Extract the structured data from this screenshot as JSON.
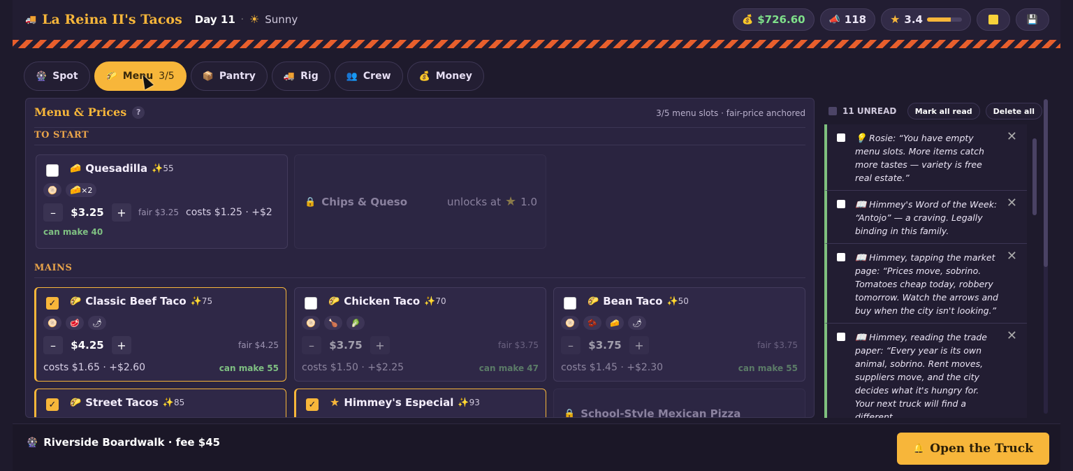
{
  "header": {
    "truck_name": "La Reina II's Tacos",
    "day": "Day 11",
    "weather": "Sunny",
    "money": "$726.60",
    "fans": "118",
    "rating": "3.4",
    "rating_fraction": 0.68
  },
  "tabs": [
    {
      "label": "Spot",
      "icon": "ferris-wheel-icon"
    },
    {
      "label": "Menu",
      "count": "3/5",
      "icon": "taco-icon"
    },
    {
      "label": "Pantry",
      "icon": "box-icon"
    },
    {
      "label": "Rig",
      "icon": "truck-icon"
    },
    {
      "label": "Crew",
      "icon": "people-icon"
    },
    {
      "label": "Money",
      "icon": "money-bag-icon"
    }
  ],
  "menu": {
    "title": "Menu & Prices",
    "help": "?",
    "note": "3/5 menu slots · fair-price anchored",
    "sections": {
      "start": "TO START",
      "mains": "MAINS"
    },
    "quesadilla": {
      "name": "Quesadilla",
      "score": "55",
      "extra": "×2",
      "price": "$3.25",
      "fair": "fair $3.25",
      "costs": "costs $1.25 · +$2",
      "make": "can make 40"
    },
    "chips": {
      "name": "Chips & Queso",
      "unlock": "unlocks at",
      "unlock_value": "1.0"
    },
    "beef": {
      "name": "Classic Beef Taco",
      "score": "75",
      "price": "$4.25",
      "fair": "fair $4.25",
      "costs": "costs $1.65 · +$2.60",
      "make": "can make 55"
    },
    "chicken": {
      "name": "Chicken Taco",
      "score": "70",
      "price": "$3.75",
      "fair": "fair $3.75",
      "costs": "costs $1.50 · +$2.25",
      "make": "can make 47"
    },
    "bean": {
      "name": "Bean Taco",
      "score": "50",
      "price": "$3.75",
      "fair": "fair $3.75",
      "costs": "costs $1.45 · +$2.30",
      "make": "can make 55"
    },
    "street": {
      "name": "Street Tacos",
      "score": "85"
    },
    "especial": {
      "name": "Himmey's Especial",
      "score": "93"
    },
    "pizza": {
      "name": "School-Style Mexican Pizza"
    }
  },
  "inbox": {
    "unread": "11 UNREAD",
    "mark_all": "Mark all read",
    "delete_all": "Delete all",
    "messages": [
      "Rosie: “You have empty menu slots. More items catch more tastes — variety is free real estate.”",
      "Himmey's Word of the Week: “Antojo” — a craving. Legally binding in this family.",
      "Himmey, tapping the market page: “Prices move, sobrino. Tomatoes cheap today, robbery tomorrow. Watch the arrows and buy when the city isn't looking.”",
      "Himmey, reading the trade paper: “Every year is its own animal, sobrino. Rent moves, suppliers move, and the city decides what it's hungry for. Your next truck will find a different"
    ]
  },
  "footer": {
    "location": "Riverside Boardwalk · fee $45",
    "open_button": "Open the Truck"
  }
}
